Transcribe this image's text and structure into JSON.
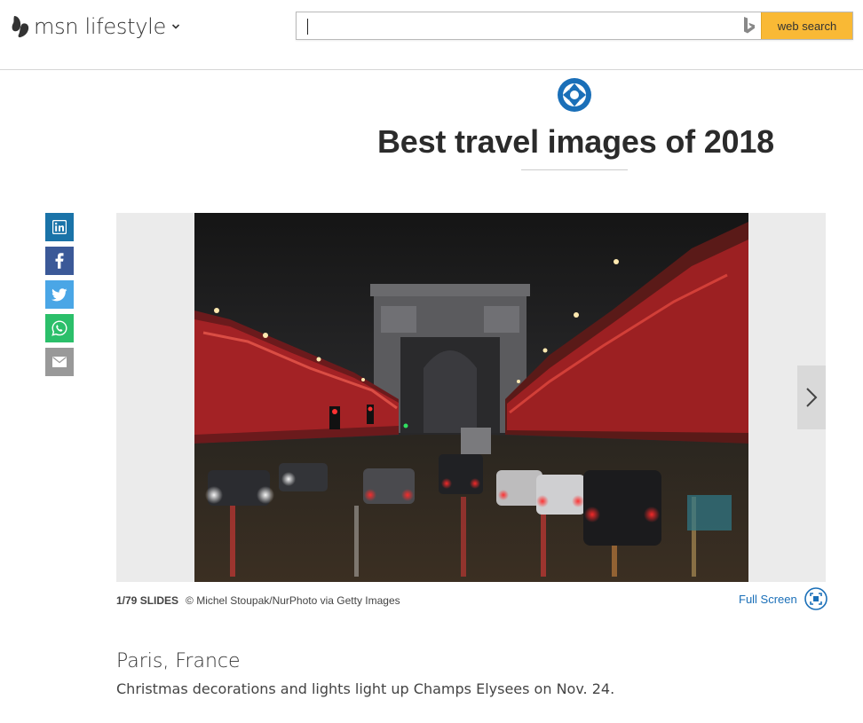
{
  "header": {
    "brand": "msn lifestyle",
    "search_placeholder": "",
    "search_button": "web search"
  },
  "article": {
    "title": "Best travel images of 2018"
  },
  "share": {
    "items": [
      "linkedin",
      "facebook",
      "twitter",
      "whatsapp",
      "email"
    ]
  },
  "slide": {
    "counter": "1/79 SLIDES",
    "credit": "© Michel Stoupak/NurPhoto via Getty Images",
    "fullscreen_label": "Full Screen",
    "caption_title": "Paris, France",
    "caption_text": "Christmas decorations and lights light up Champs Elysees on Nov. 24."
  },
  "colors": {
    "accent_blue": "#1a6fb8",
    "search_button": "#f9b935",
    "linkedin": "#1a73a8",
    "facebook": "#3b5998",
    "twitter": "#4aa6e6",
    "whatsapp": "#2bbf6a",
    "email": "#999999"
  }
}
